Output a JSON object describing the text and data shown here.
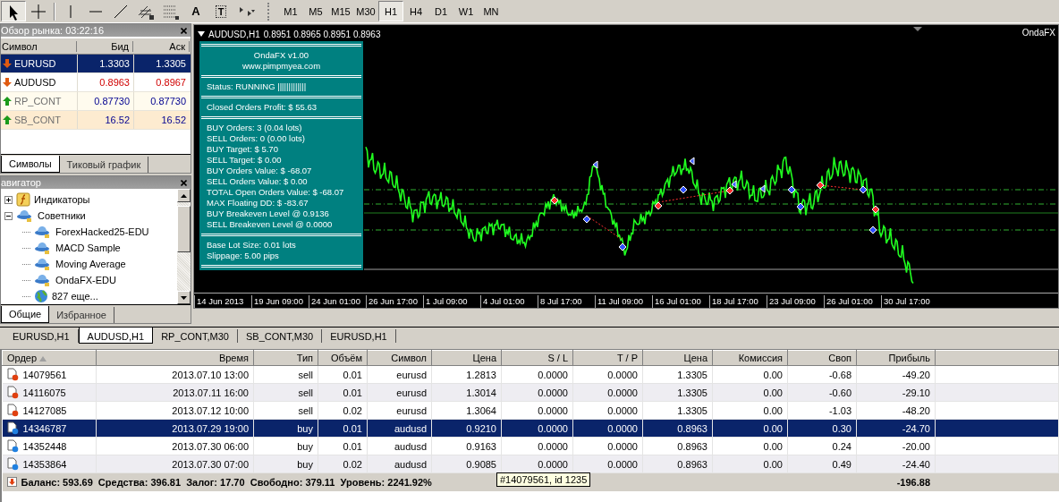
{
  "toolbar": {
    "tools": [
      {
        "kind": "cursor",
        "selected": true
      },
      {
        "kind": "crosshair",
        "selected": false
      },
      {
        "kind": "vline",
        "selected": false
      },
      {
        "kind": "hline",
        "selected": false
      },
      {
        "kind": "trend",
        "selected": false
      },
      {
        "kind": "channel",
        "selected": false
      },
      {
        "kind": "fibo",
        "selected": false
      },
      {
        "kind": "text",
        "label": "A",
        "selected": false
      },
      {
        "kind": "label",
        "label": "T",
        "selected": false
      },
      {
        "kind": "arrows",
        "selected": false
      }
    ],
    "timeframes": [
      {
        "label": "M1",
        "selected": false
      },
      {
        "label": "M5",
        "selected": false
      },
      {
        "label": "M15",
        "selected": false
      },
      {
        "label": "M30",
        "selected": false
      },
      {
        "label": "H1",
        "selected": true
      },
      {
        "label": "H4",
        "selected": false
      },
      {
        "label": "D1",
        "selected": false
      },
      {
        "label": "W1",
        "selected": false
      },
      {
        "label": "MN",
        "selected": false
      }
    ]
  },
  "market_watch": {
    "title": "Обзор рынка: 03:22:16",
    "columns": [
      "Символ",
      "Бид",
      "Аск"
    ],
    "rows": [
      {
        "symbol": "EURUSD",
        "bid": "1.3303",
        "ask": "1.3305",
        "kind": "down",
        "selected": true
      },
      {
        "symbol": "AUDUSD",
        "bid": "0.8963",
        "ask": "0.8967",
        "kind": "down",
        "selected": false
      },
      {
        "symbol": "RP_CONT",
        "bid": "0.87730",
        "ask": "0.87730",
        "kind": "up",
        "selected": false
      },
      {
        "symbol": "SB_CONT",
        "bid": "16.52",
        "ask": "16.52",
        "kind": "up",
        "selected": false
      }
    ],
    "tabs": [
      {
        "label": "Символы",
        "selected": true
      },
      {
        "label": "Тиковый график",
        "selected": false
      }
    ]
  },
  "navigator": {
    "title": "авигатор",
    "tree": [
      {
        "label": "Индикаторы",
        "kind": "indicators",
        "expanded": false
      },
      {
        "label": "Советники",
        "kind": "experts",
        "expanded": true,
        "children": [
          {
            "label": "ForexHacked25-EDU",
            "kind": "expert"
          },
          {
            "label": "MACD Sample",
            "kind": "expert"
          },
          {
            "label": "Moving Average",
            "kind": "expert"
          },
          {
            "label": "OndaFX-EDU",
            "kind": "expert"
          },
          {
            "label": "827 еще...",
            "kind": "more"
          }
        ]
      }
    ],
    "tabs": [
      {
        "label": "Общие",
        "selected": true
      },
      {
        "label": "Избранное",
        "selected": false
      }
    ]
  },
  "chart": {
    "symbol": "AUDUSD,H1",
    "ohlc": "0.8951 0.8965 0.8951 0.8963",
    "expert": "OndaFX",
    "info_panel": [
      [
        "OndaFX v1.00",
        "www.pimpmyea.com"
      ],
      [
        "Status: RUNNING |||||||||||||"
      ],
      [
        "Closed Orders Profit: $ 55.63"
      ],
      [
        "BUY Orders: 3 (0.04 lots)",
        "SELL Orders: 0 (0.00 lots)",
        "BUY Target: $ 5.70",
        "SELL Target: $ 0.00",
        "BUY Orders Value: $ -68.07",
        "SELL Orders Value: $ 0.00",
        "TOTAL Open Orders Value: $ -68.07",
        "MAX Floating DD: $ -83.67",
        "BUY Breakeven Level @ 0.9136",
        "SELL Breakeven Level @ 0.0000"
      ],
      [
        "Base Lot Size: 0.01 lots",
        "Slippage: 5.00 pips"
      ]
    ],
    "time_labels": [
      "14 Jun 2013",
      "19 Jun 09:00",
      "24 Jun 01:00",
      "26 Jun 17:00",
      "1 Jul 09:00",
      "4 Jul 01:00",
      "8 Jul 17:00",
      "11 Jul 09:00",
      "16 Jul 01:00",
      "18 Jul 17:00",
      "23 Jul 09:00",
      "26 Jul 01:00",
      "30 Jul 17:00"
    ]
  },
  "chart_tabs": [
    {
      "label": "EURUSD,H1",
      "selected": false
    },
    {
      "label": "AUDUSD,H1",
      "selected": true
    },
    {
      "label": "RP_CONT,M30",
      "selected": false
    },
    {
      "label": "SB_CONT,M30",
      "selected": false
    },
    {
      "label": "EURUSD,H1",
      "selected": false
    }
  ],
  "orders": {
    "columns": [
      "Ордер",
      "Время",
      "Тип",
      "Объём",
      "Символ",
      "Цена",
      "S / L",
      "T / P",
      "Цена",
      "Комиссия",
      "Своп",
      "Прибыль"
    ],
    "rows": [
      {
        "kind": "sell",
        "selected": false,
        "cells": [
          "14079561",
          "2013.07.10 13:00",
          "sell",
          "0.01",
          "eurusd",
          "1.2813",
          "0.0000",
          "0.0000",
          "1.3305",
          "0.00",
          "-0.68",
          "-49.20"
        ]
      },
      {
        "kind": "sell",
        "selected": false,
        "cells": [
          "14116075",
          "2013.07.11 16:00",
          "sell",
          "0.01",
          "eurusd",
          "1.3014",
          "0.0000",
          "0.0000",
          "1.3305",
          "0.00",
          "-0.60",
          "-29.10"
        ]
      },
      {
        "kind": "sell",
        "selected": false,
        "cells": [
          "14127085",
          "2013.07.12 10:00",
          "sell",
          "0.02",
          "eurusd",
          "1.3064",
          "0.0000",
          "0.0000",
          "1.3305",
          "0.00",
          "-1.03",
          "-48.20"
        ]
      },
      {
        "kind": "buy",
        "selected": true,
        "cells": [
          "14346787",
          "2013.07.29 19:00",
          "buy",
          "0.01",
          "audusd",
          "0.9210",
          "0.0000",
          "0.0000",
          "0.8963",
          "0.00",
          "0.30",
          "-24.70"
        ]
      },
      {
        "kind": "buy",
        "selected": false,
        "cells": [
          "14352448",
          "2013.07.30 06:00",
          "buy",
          "0.01",
          "audusd",
          "0.9163",
          "0.0000",
          "0.0000",
          "0.8963",
          "0.00",
          "0.24",
          "-20.00"
        ]
      },
      {
        "kind": "buy",
        "selected": false,
        "cells": [
          "14353864",
          "2013.07.30 07:00",
          "buy",
          "0.02",
          "audusd",
          "0.9085",
          "0.0000",
          "0.0000",
          "0.8963",
          "0.00",
          "0.49",
          "-24.40"
        ]
      }
    ],
    "summary": "Баланс: 593.69  Средства: 396.81  Залог: 17.70  Свободно: 379.11  Уровень: 2241.92%",
    "total": "-196.88",
    "tooltip": "#14079561, id 1235"
  }
}
